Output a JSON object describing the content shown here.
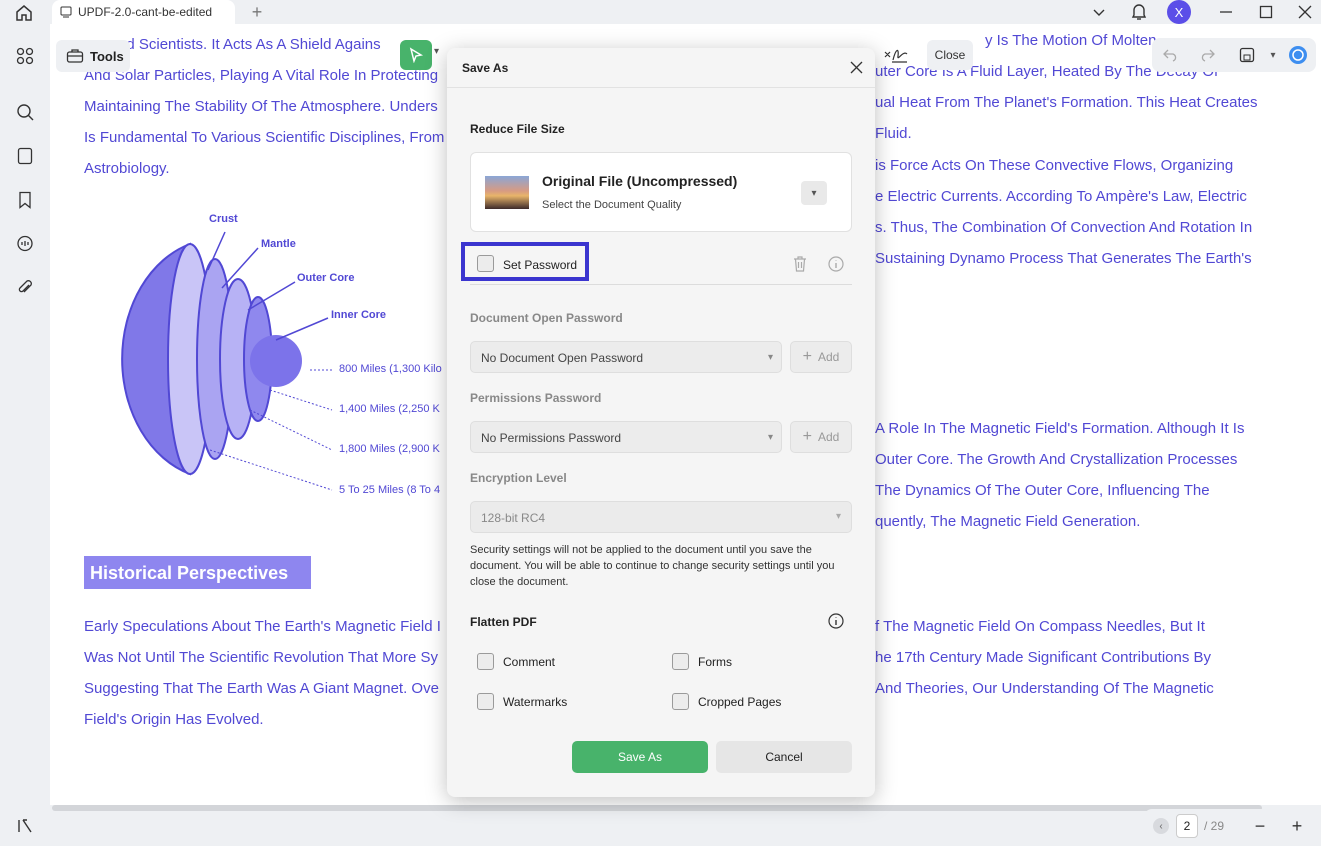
{
  "tab": {
    "title": "UPDF-2.0-cant-be-edited"
  },
  "user": {
    "avatar_letter": "X"
  },
  "toolbar": {
    "tools_label": "Tools",
    "close_label": "Close"
  },
  "document": {
    "lines_left": [
      "ed Scientists. It Acts As A Shield Agains",
      "And Solar Particles, Playing A Vital Role In Protecting",
      "Maintaining The Stability Of The Atmosphere. Unders",
      "Is Fundamental To Various Scientific Disciplines, From",
      "Astrobiology."
    ],
    "lines_right_top": [
      "y Is The Motion Of Molten",
      "uter Core Is A Fluid Layer, Heated By The Decay Of",
      "ual Heat From The Planet's Formation. This Heat Creates",
      "Fluid.",
      "is Force Acts On These Convective Flows, Organizing",
      "e Electric Currents. According To Ampère's Law, Electric",
      "s. Thus, The Combination Of Convection And Rotation In",
      "Sustaining Dynamo Process That Generates The Earth's"
    ],
    "lines_right_mid": [
      "A Role In The Magnetic Field's Formation. Although It Is",
      "Outer Core. The Growth And Crystallization Processes",
      "The Dynamics Of The Outer Core, Influencing The",
      "quently, The Magnetic Field Generation."
    ],
    "heading": "Historical Perspectives",
    "lines_left_bottom": [
      "Early Speculations About The Earth's Magnetic Field I",
      "Was Not Until The Scientific Revolution That More Sy",
      "Suggesting That The Earth Was A Giant Magnet. Ove",
      "Field's Origin Has Evolved."
    ],
    "lines_right_bottom": [
      "f The Magnetic Field On Compass Needles, But It",
      "he 17th Century Made Significant Contributions By",
      "And Theories, Our Understanding Of The Magnetic"
    ],
    "diagram": {
      "crust": "Crust",
      "mantle": "Mantle",
      "outer_core": "Outer Core",
      "inner_core": "Inner Core",
      "d1": "800 Miles (1,300 Kilo",
      "d2": "1,400 Miles (2,250 K",
      "d3": "1,800 Miles (2,900 K",
      "d4": "5 To 25 Miles (8 To 4"
    }
  },
  "pagination": {
    "current": "2",
    "total": "/ 29"
  },
  "dialog": {
    "title": "Save As",
    "reduce_title": "Reduce File Size",
    "quality_title": "Original File (Uncompressed)",
    "quality_sub": "Select the Document Quality",
    "set_password": "Set Password",
    "open_pw_title": "Document Open Password",
    "open_pw_value": "No Document Open Password",
    "perm_pw_title": "Permissions Password",
    "perm_pw_value": "No Permissions Password",
    "add_label": "Add",
    "enc_title": "Encryption Level",
    "enc_value": "128-bit RC4",
    "note": "Security settings will not be applied to the document until you save the document. You will be able to continue to change security settings until you close the document.",
    "flatten_title": "Flatten PDF",
    "flatten": {
      "comment": "Comment",
      "forms": "Forms",
      "watermarks": "Watermarks",
      "cropped": "Cropped Pages"
    },
    "save_label": "Save As",
    "cancel_label": "Cancel"
  },
  "colors": {
    "accent": "#48b36b",
    "doc_text": "#5148d4",
    "highlight_border": "#3b35cf"
  }
}
